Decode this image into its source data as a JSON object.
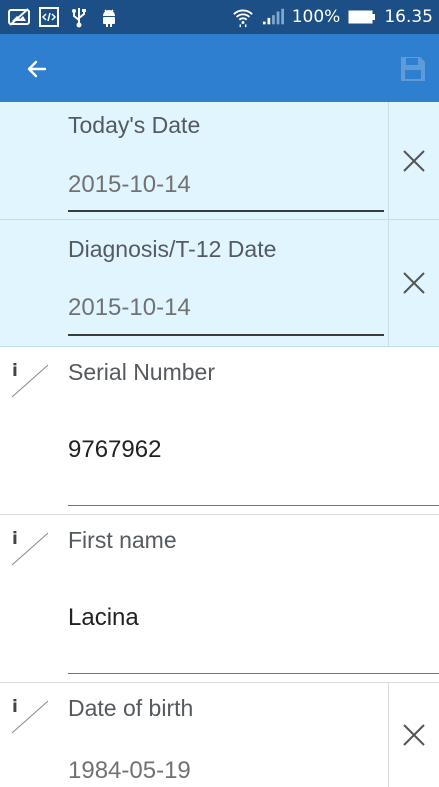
{
  "status_bar": {
    "icons_left": [
      "photo-off-icon",
      "code-box-icon",
      "usb-icon",
      "android-icon"
    ],
    "icons_right": [
      "wifi-icon",
      "signal-icon",
      "battery-icon"
    ],
    "battery": "100%",
    "time": "16.35"
  },
  "toolbar": {
    "back_icon": "arrow-left-icon",
    "save_icon": "save-icon"
  },
  "form": {
    "todays_date": {
      "label": "Today's Date",
      "value": "2015-10-14"
    },
    "diagnosis_date": {
      "label": "Diagnosis/T-12 Date",
      "value": "2015-10-14"
    },
    "serial_number": {
      "label": "Serial Number",
      "value": "9767962"
    },
    "first_name": {
      "label": "First name",
      "value": "Lacina"
    },
    "date_of_birth": {
      "label": "Date of birth",
      "value": "1984-05-19"
    }
  },
  "colors": {
    "status_bar": "#1c4f86",
    "app_bar": "#2f7fd0",
    "field_highlight": "#e1f5fe",
    "text_label": "#555a5f"
  }
}
